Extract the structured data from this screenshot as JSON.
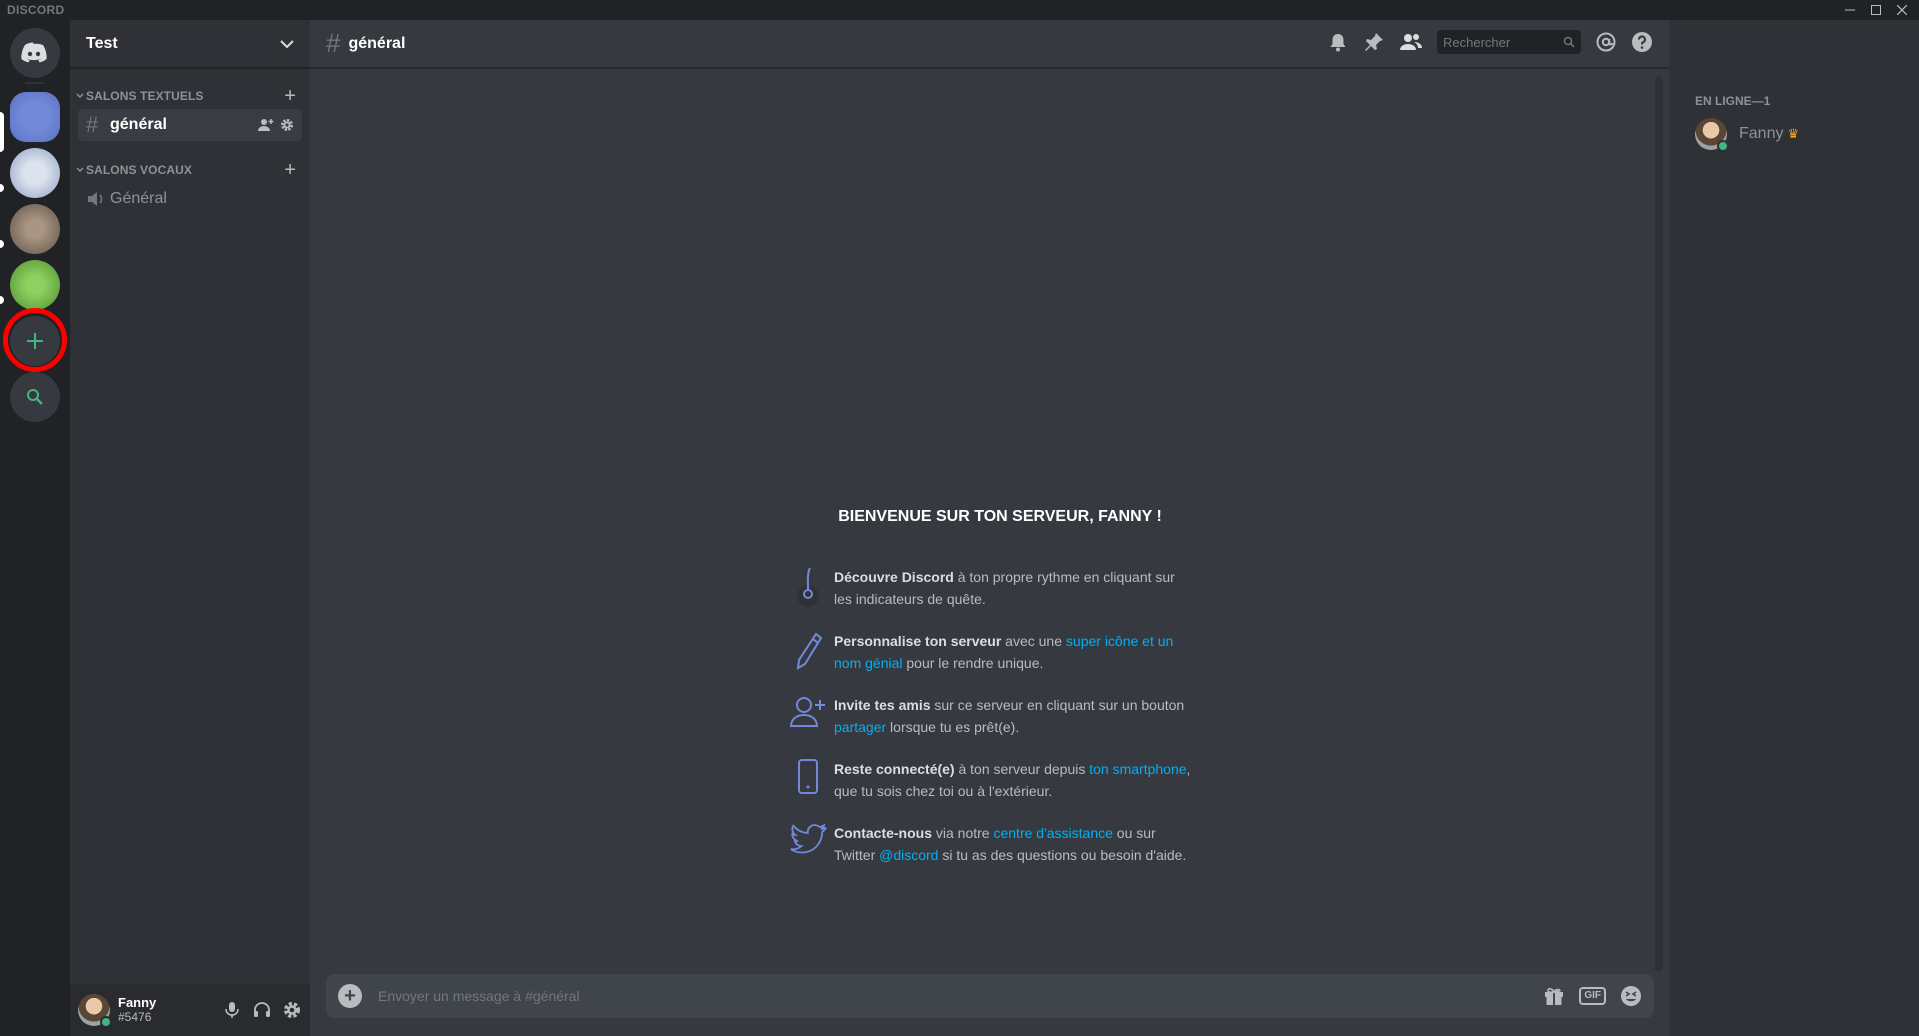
{
  "app": {
    "brand": "DISCORD"
  },
  "window_controls": [
    "minimize-icon",
    "maximize-icon",
    "close-icon"
  ],
  "guilds": {
    "items": [
      {
        "name": "home-icon",
        "color": "#36393f",
        "active": false
      },
      {
        "name": "server-1",
        "color": "#7289da",
        "active": true
      },
      {
        "name": "server-2",
        "color": "#b9c4d8",
        "active": false
      },
      {
        "name": "server-3",
        "color": "#8d7f70",
        "active": false
      },
      {
        "name": "server-4",
        "color": "#6ab04c",
        "active": false
      }
    ],
    "add_server_icon": "plus-icon",
    "explore_icon": "search-icon",
    "accent_green": "#43b581"
  },
  "server": {
    "name": "Test",
    "categories": [
      {
        "label": "SALONS TEXTUELS",
        "channels": [
          {
            "name": "général",
            "type": "text",
            "active": true
          }
        ]
      },
      {
        "label": "SALONS VOCAUX",
        "channels": [
          {
            "name": "Général",
            "type": "voice",
            "active": false
          }
        ]
      }
    ]
  },
  "user": {
    "name": "Fanny",
    "discriminator": "#5476",
    "status_color": "#43b581"
  },
  "chat": {
    "channel": "général",
    "search_placeholder": "Rechercher",
    "composer_placeholder": "Envoyer un message à #général",
    "gif_label": "GIF"
  },
  "welcome": {
    "title": "Bienvenue sur ton serveur, Fanny !",
    "items": [
      {
        "icon": "quest-icon",
        "bold": "Découvre Discord",
        "t1": " à ton propre rythme en cliquant sur les indicateurs de quête.",
        "link": "",
        "t2": ""
      },
      {
        "icon": "pencil-icon",
        "bold": "Personnalise ton serveur",
        "t1": " avec une ",
        "link": "super icône et un nom génial",
        "t2": " pour le rendre unique."
      },
      {
        "icon": "add-friend-icon",
        "bold": "Invite tes amis",
        "t1": " sur ce serveur en cliquant sur un bouton ",
        "link": "partager",
        "t2": " lorsque tu es prêt(e)."
      },
      {
        "icon": "smartphone-icon",
        "bold": "Reste connecté(e)",
        "t1": " à ton serveur depuis ",
        "link": "ton smartphone",
        "t2": ", que tu sois chez toi ou à l'extérieur."
      },
      {
        "icon": "twitter-icon",
        "bold": "Contacte-nous",
        "t1": " via notre ",
        "link": "centre d'assistance",
        "t2": " ou sur Twitter ",
        "link2": "@discord",
        "t3": " si tu as des questions ou besoin d'aide."
      }
    ],
    "link_color": "#00b0f4"
  },
  "members": {
    "header": "En ligne—1",
    "list": [
      {
        "name": "Fanny",
        "owner": true
      }
    ]
  },
  "annotation": {
    "color": "#ff0000"
  }
}
